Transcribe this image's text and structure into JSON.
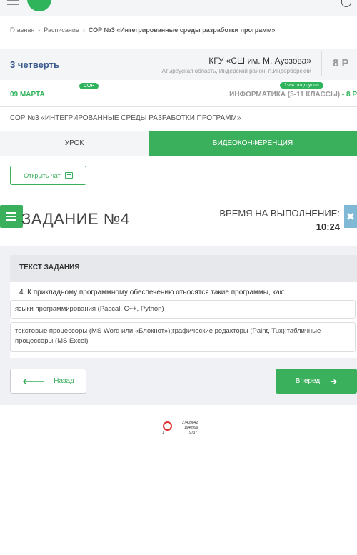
{
  "breadcrumb": {
    "home": "Главная",
    "schedule": "Расписание",
    "current": "СОР №3 «Интегрированные среды разработки программ»"
  },
  "header": {
    "quarter": "3 четверть",
    "school_name": "КГУ «СШ им. М. Ауэзова»",
    "school_address": "Атырауская область, Индерский район, п.Индерборский",
    "grade": "8 Р"
  },
  "lesson": {
    "sor_badge": "СОР",
    "subgroup_badge": "1-ая подгруппа",
    "date": "09 МАРТА",
    "subject": "ИНФОРМАТИКА (5-11 КЛАССЫ)",
    "subject_sep": " - ",
    "subject_grade": "8 Р",
    "title": "СОР №3 «ИНТЕГРИРОВАННЫЕ СРЕДЫ РАЗРАБОТКИ ПРОГРАММ»"
  },
  "tabs": {
    "lesson": "УРОК",
    "video": "ВИДЕОКОНФЕРЕНЦИЯ"
  },
  "chat_button": "Открыть чат",
  "task": {
    "title": "ЗАДАНИЕ №4",
    "time_label": "ВРЕМЯ НА ВЫПОЛНЕНИЕ:",
    "time_value": "10:24",
    "section_label": "ТЕКСТ ЗАДАНИЯ",
    "question": "4. К прикладному программному обеспечению относятся такие программы, как:",
    "answers": [
      "языки программирования (Pascal, C++, Python)",
      "текстовые процессоры (MS Word или «Блокнот»);графические редакторы (Paint, Tux);табличные процессоры (MS Excel)"
    ]
  },
  "nav": {
    "back": "Назад",
    "next": "Вперед"
  },
  "stamp": {
    "n1": "27409842",
    "n2": "1940999",
    "n3": "9737",
    "n4": "1"
  },
  "colors": {
    "accent": "#3aaf5c",
    "title_blue": "#3a5a8c",
    "close_blue": "#7fb9d6"
  }
}
